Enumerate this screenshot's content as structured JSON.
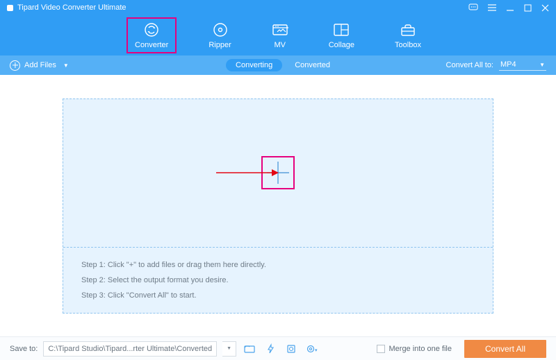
{
  "title": "Tipard Video Converter Ultimate",
  "nav": {
    "converter": "Converter",
    "ripper": "Ripper",
    "mv": "MV",
    "collage": "Collage",
    "toolbox": "Toolbox"
  },
  "toolbar": {
    "add_files": "Add Files",
    "tab_converting": "Converting",
    "tab_converted": "Converted",
    "convert_all_to": "Convert All to:",
    "format": "MP4"
  },
  "steps": {
    "s1": "Step 1: Click \"+\" to add files or drag them here directly.",
    "s2": "Step 2: Select the output format you desire.",
    "s3": "Step 3: Click \"Convert All\" to start."
  },
  "footer": {
    "save_to": "Save to:",
    "path": "C:\\Tipard Studio\\Tipard...rter Ultimate\\Converted",
    "merge": "Merge into one file",
    "convert_all": "Convert All"
  }
}
